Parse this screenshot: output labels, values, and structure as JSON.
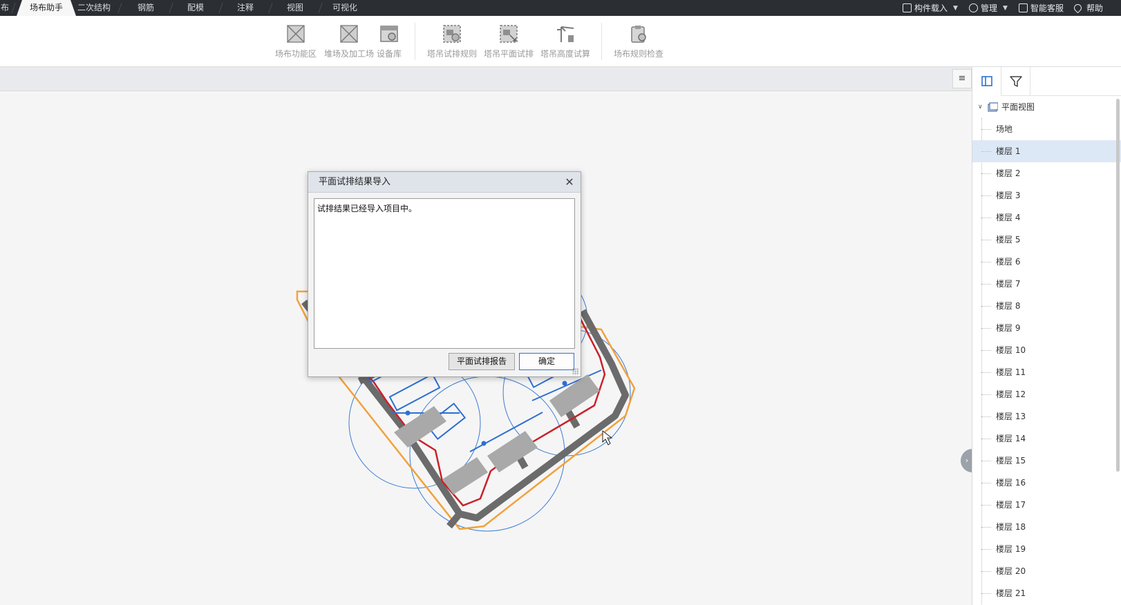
{
  "menubar": {
    "tabs": [
      {
        "label": "布",
        "active": false
      },
      {
        "label": "场布助手",
        "active": true
      },
      {
        "label": "二次结构",
        "active": false
      },
      {
        "label": "钢筋",
        "active": false
      },
      {
        "label": "配模",
        "active": false
      },
      {
        "label": "注释",
        "active": false
      },
      {
        "label": "视图",
        "active": false
      },
      {
        "label": "可视化",
        "active": false
      }
    ],
    "right": {
      "component_load": "构件载入",
      "manage": "管理",
      "smart_service": "智能客服",
      "help": "帮助"
    }
  },
  "ribbon": {
    "buttons": [
      {
        "label": "场布功能区",
        "icon": "functional-area-icon"
      },
      {
        "label": "堆场及加工场",
        "icon": "storage-yard-icon"
      },
      {
        "label": "设备库",
        "icon": "equipment-library-icon"
      },
      {
        "label": "塔吊试排规则",
        "icon": "crane-rule-icon"
      },
      {
        "label": "塔吊平面试排",
        "icon": "crane-plan-icon"
      },
      {
        "label": "塔吊高度试算",
        "icon": "crane-height-icon"
      },
      {
        "label": "场布规则检查",
        "icon": "rule-check-icon"
      }
    ]
  },
  "viewbar": {
    "menu_icon": "≡"
  },
  "panel": {
    "root_label": "平面视图",
    "items": [
      "场地",
      "楼层 1",
      "楼层 2",
      "楼层 3",
      "楼层 4",
      "楼层 5",
      "楼层 6",
      "楼层 7",
      "楼层 8",
      "楼层 9",
      "楼层 10",
      "楼层 11",
      "楼层 12",
      "楼层 13",
      "楼层 14",
      "楼层 15",
      "楼层 16",
      "楼层 17",
      "楼层 18",
      "楼层 19",
      "楼层 20",
      "楼层 21"
    ],
    "selected": "楼层 1"
  },
  "dialog": {
    "title": "平面试排结果导入",
    "message": "试排结果已经导入项目中。",
    "report_button": "平面试排报告",
    "ok_button": "确定"
  },
  "colors": {
    "menubar": "#2b2e33",
    "site_boundary": "#f0a23c",
    "red_fence": "#c8222b",
    "crane_blue": "#2f6fd0",
    "road_gray": "#6b6b6b"
  }
}
